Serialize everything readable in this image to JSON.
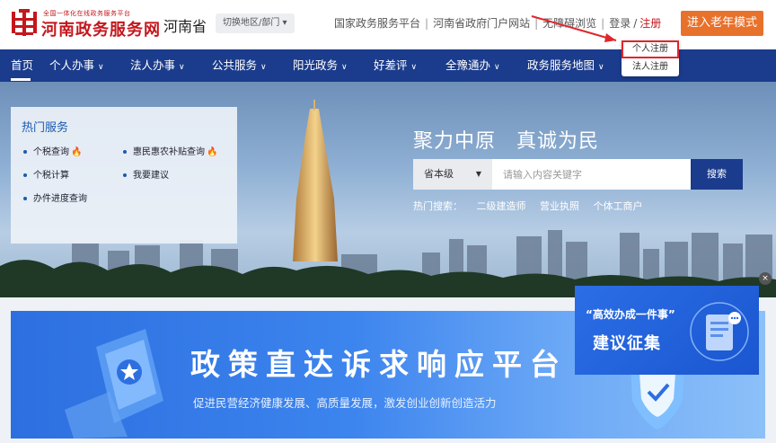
{
  "header": {
    "logo_small": "全国一体化在线政务服务平台",
    "logo_title": "河南政务服务网",
    "province": "河南省",
    "switch_region": "切换地区/部门 ▾",
    "links": {
      "national": "国家政务服务平台",
      "portal": "河南省政府门户网站",
      "accessible": "无障碍浏览",
      "login": "登录",
      "slash": "/",
      "register": "注册"
    },
    "elder_mode": "进入老年模式"
  },
  "nav": {
    "items": [
      {
        "label": "首页"
      },
      {
        "label": "个人办事"
      },
      {
        "label": "法人办事"
      },
      {
        "label": "公共服务"
      },
      {
        "label": "阳光政务"
      },
      {
        "label": "好差评"
      },
      {
        "label": "全豫通办"
      },
      {
        "label": "政务服务地图"
      }
    ],
    "caret": "∨"
  },
  "register_dropdown": {
    "personal": "个人注册",
    "corporate": "法人注册"
  },
  "hot_services": {
    "title": "热门服务",
    "items": [
      "个税查询",
      "惠民惠农补贴查询",
      "个税计算",
      "我要建议",
      "办件进度查询"
    ],
    "fire": "🔥"
  },
  "hero": {
    "slogan": "聚力中原　真诚为民",
    "search": {
      "level": "省本级",
      "level_caret": "▼",
      "placeholder": "请输入内容关键字",
      "button": "搜索"
    },
    "hot_search_label": "热门搜索：",
    "hot_search_terms": [
      "二级建造师",
      "营业执照",
      "个体工商户"
    ]
  },
  "policy_banner": {
    "title": "政策直达诉求响应平台",
    "subtitle": "促进民营经济健康发展、高质量发展，激发创业创新创造活力"
  },
  "suggest_card": {
    "quote": "“高效办成一件事”",
    "title": "建议征集",
    "close": "×"
  },
  "colors": {
    "brand_red": "#c4161c",
    "nav_blue": "#1b3c8c",
    "elder_orange": "#e8712b",
    "highlight_red": "#e0262c"
  }
}
